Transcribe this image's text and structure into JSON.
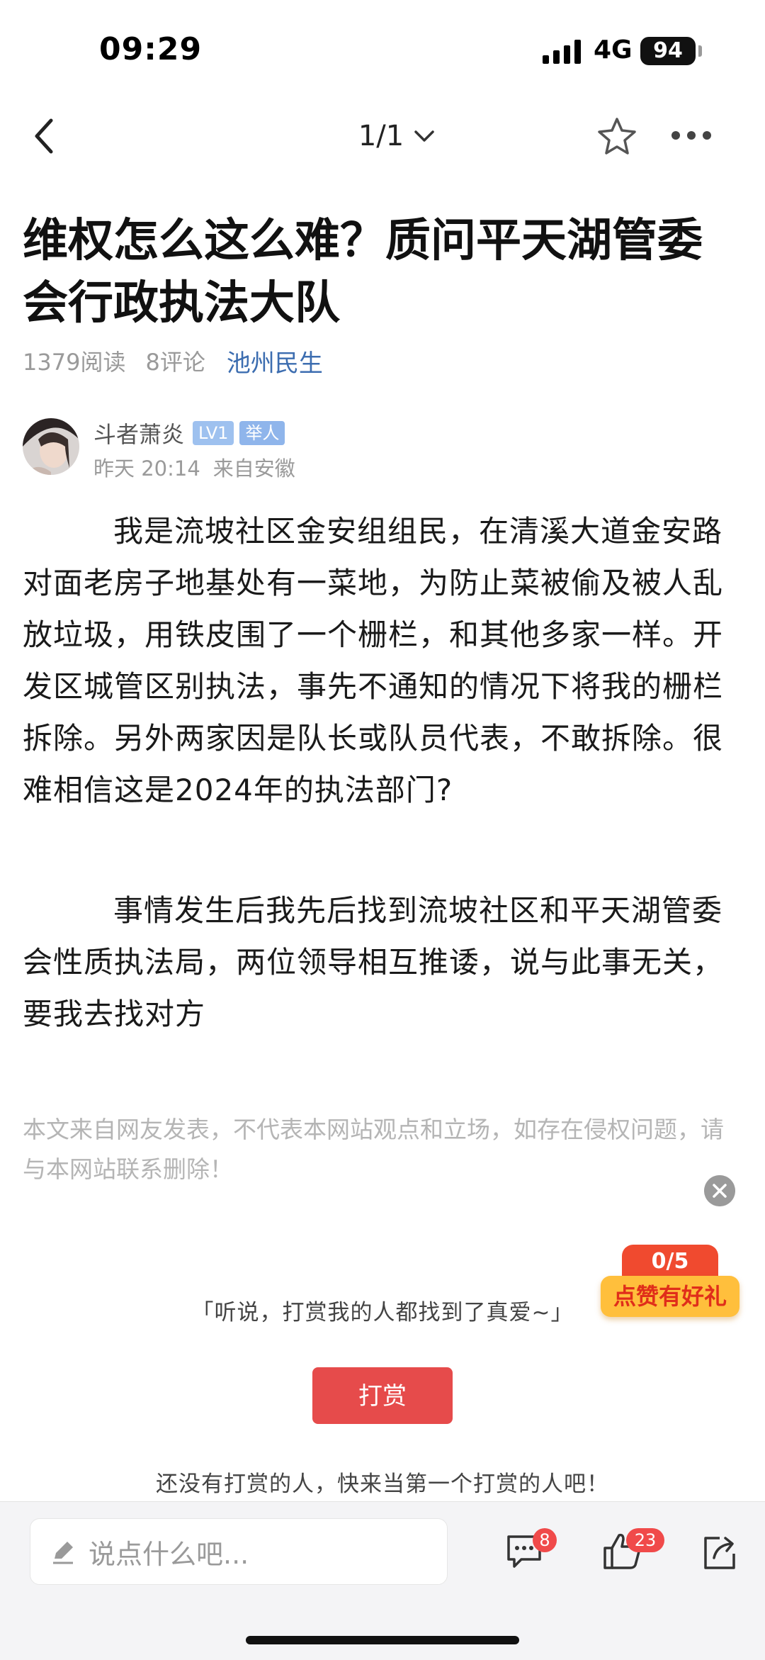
{
  "status_bar": {
    "time": "09:29",
    "network": "4G",
    "battery": "94"
  },
  "nav": {
    "page_indicator": "1/1"
  },
  "article": {
    "title": "维权怎么这么难？质问平天湖管委会行政执法大队",
    "reads": "1379阅读",
    "comments": "8评论",
    "channel": "池州民生",
    "author": {
      "name": "斗者萧炎",
      "level": "LV1",
      "role": "举人",
      "date": "昨天 20:14",
      "location": "来自安徽"
    },
    "paragraphs": [
      "我是流坡社区金安组组民，在清溪大道金安路对面老房子地基处有一菜地，为防止菜被偷及被人乱放垃圾，用铁皮围了一个栅栏，和其他多家一样。开发区城管区别执法，事先不通知的情况下将我的栅栏拆除。另外两家因是队长或队员代表，不敢拆除。很难相信这是2024年的执法部门?",
      "事情发生后我先后找到流坡社区和平天湖管委会性质执法局，两位领导相互推诿，说与此事无关，要我去找对方"
    ],
    "disclaimer": "本文来自网友发表，不代表本网站观点和立场，如存在侵权问题，请与本网站联系删除！"
  },
  "promo": {
    "count": "0/5",
    "label": "点赞有好礼"
  },
  "tip": {
    "quote": "「听说，打赏我的人都找到了真爱~」",
    "button_label": "打赏",
    "empty_text": "还没有打赏的人，快来当第一个打赏的人吧！"
  },
  "bottom_bar": {
    "input_placeholder": "说点什么吧...",
    "comment_count": "8",
    "like_count": "23"
  },
  "colors": {
    "accent_red": "#e64b4b",
    "channel_blue": "#3c6db0",
    "promo_yellow": "#ffbf3c"
  }
}
